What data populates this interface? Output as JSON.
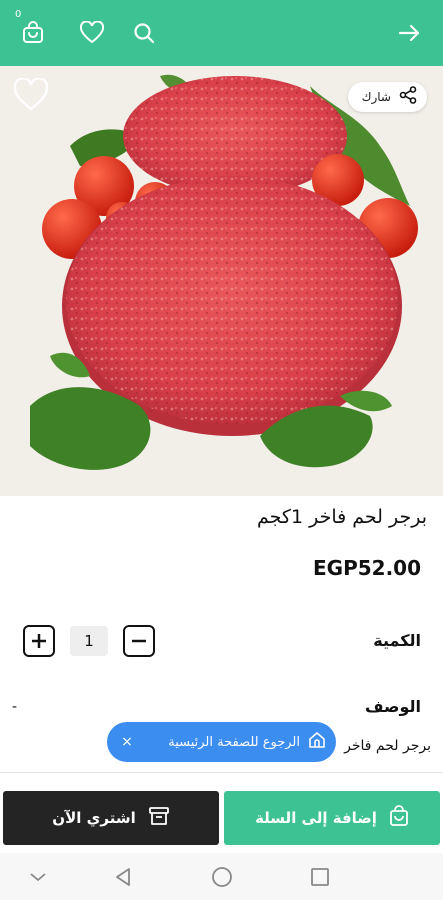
{
  "header": {
    "cart_count": "0",
    "icons": [
      "cart-icon",
      "heart-icon",
      "search-icon",
      "arrow-right-icon"
    ],
    "accent_color": "#3cc293"
  },
  "hero": {
    "share_label": "شارك",
    "share_icon": "share-icon",
    "favorite_icon": "heart-outline-icon"
  },
  "product": {
    "title": "برجر لحم فاخر 1كجم",
    "price": "EGP52.00"
  },
  "quantity": {
    "label": "الكمية",
    "value": "1"
  },
  "description": {
    "label": "الوصف",
    "toggle": "-",
    "text": "برجر لحم فاخر"
  },
  "home_chip": {
    "label": "الرجوع للصفحة الرئيسية",
    "close": "×",
    "chip_color": "#3b8df0"
  },
  "actions": {
    "buy_now": "اشتري الآن",
    "add_to_cart": "إضافة إلى السلة"
  },
  "system_nav": {
    "icons": [
      "chevron-down-icon",
      "back-triangle-icon",
      "home-circle-icon",
      "recents-square-icon"
    ]
  }
}
